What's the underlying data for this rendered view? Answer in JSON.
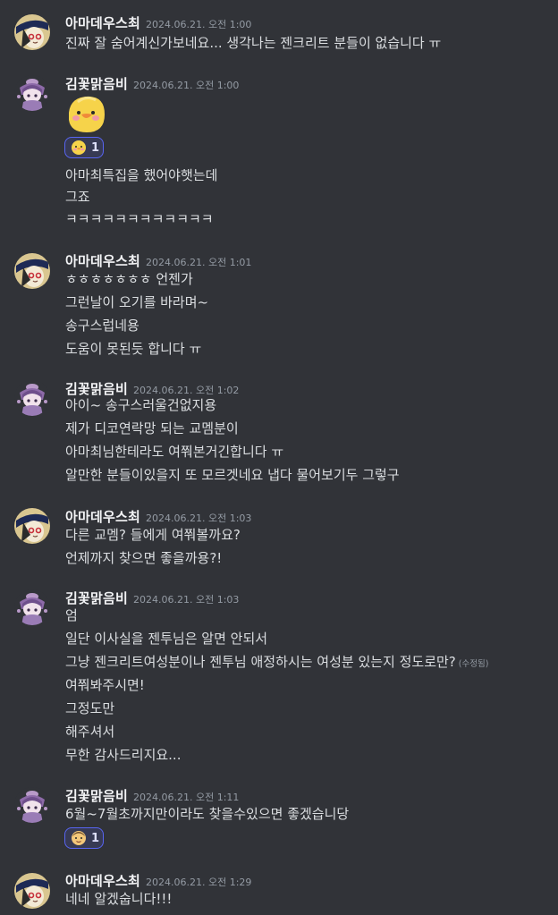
{
  "users": {
    "amadeus": {
      "name": "아마데우스최"
    },
    "gimkkot": {
      "name": "김꽃맑음비"
    }
  },
  "messages": [
    {
      "author": "아마데우스최",
      "time": "2024.06.21. 오전 1:00",
      "lines": [
        "진짜 잘 숨어계신가보네요... 생각나는 젠크리트 분들이 없습니다 ㅠ"
      ]
    },
    {
      "author": "김꽃맑음비",
      "time": "2024.06.21. 오전 1:00",
      "sticker": "yellow-duck-emoji",
      "reaction": {
        "icon": "duck-emoji",
        "count": "1"
      },
      "lines": [
        "아마최특집을 했어야햇는데",
        "그죠",
        "ㅋㅋㅋㅋㅋㅋㅋㅋㅋㅋㅋㅋ"
      ]
    },
    {
      "author": "아마데우스최",
      "time": "2024.06.21. 오전 1:01",
      "lines": [
        "ㅎㅎㅎㅎㅎㅎㅎ 언젠가",
        "그런날이 오기를 바라며~",
        "송구스럽네용",
        "도움이 못된듯 합니다 ㅠ"
      ]
    },
    {
      "author": "김꽃맑음비",
      "time": "2024.06.21. 오전 1:02",
      "lines": [
        "아이~ 송구스러울건없지용",
        "제가 디코연락망 되는 교멤분이",
        "아마최님한테라도 여쭤본거긴합니다 ㅠ",
        "알만한 분들이있을지 또 모르겟네요 냅다 물어보기두 그렇구"
      ]
    },
    {
      "author": "아마데우스최",
      "time": "2024.06.21. 오전 1:03",
      "lines": [
        "다른 교멤? 들에게 여쭤볼까요?",
        "언제까지 찾으면 좋을까용?!"
      ]
    },
    {
      "author": "김꽃맑음비",
      "time": "2024.06.21. 오전 1:03",
      "lines": [
        "엄",
        "일단 이사실을 젠투님은 알면 안되서",
        "그냥 젠크리트여성분이나 젠투님 애정하시는 여성분 있는지 정도로만?",
        "여쭤봐주시면!",
        "그정도만",
        "해주셔서",
        "무한 감사드리지요..."
      ],
      "edited_label": "(수정됨)"
    },
    {
      "author": "김꽃맑음비",
      "time": "2024.06.21. 오전 1:11",
      "reaction": {
        "icon": "face-emoji",
        "count": "1"
      },
      "lines": [
        "6월~7월초까지만이라도 찾을수있으면 좋겠습니당"
      ]
    },
    {
      "author": "아마데우스최",
      "time": "2024.06.21. 오전 1:29",
      "lines": [
        "네네 알겠숩니다!!!"
      ]
    }
  ]
}
